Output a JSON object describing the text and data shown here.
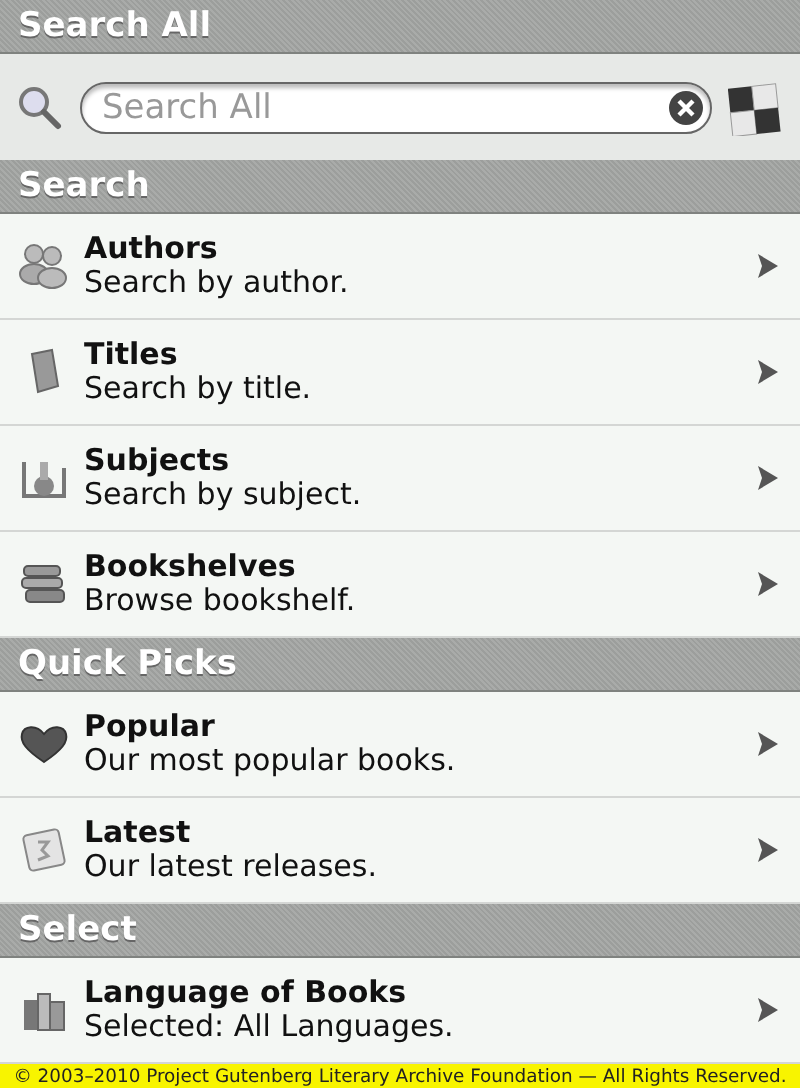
{
  "header": {
    "title": "Search All"
  },
  "search": {
    "placeholder": "Search All"
  },
  "sections": [
    {
      "title": "Search",
      "items": [
        {
          "title": "Authors",
          "subtitle": "Search by author."
        },
        {
          "title": "Titles",
          "subtitle": "Search by title."
        },
        {
          "title": "Subjects",
          "subtitle": "Search by subject."
        },
        {
          "title": "Bookshelves",
          "subtitle": "Browse bookshelf."
        }
      ]
    },
    {
      "title": "Quick Picks",
      "items": [
        {
          "title": "Popular",
          "subtitle": "Our most popular books."
        },
        {
          "title": "Latest",
          "subtitle": "Our latest releases."
        }
      ]
    },
    {
      "title": "Select",
      "items": [
        {
          "title": "Language of Books",
          "subtitle": "Selected: All Languages."
        }
      ]
    }
  ],
  "footer": "© 2003–2010 Project Gutenberg Literary Archive Foundation — All Rights Reserved."
}
